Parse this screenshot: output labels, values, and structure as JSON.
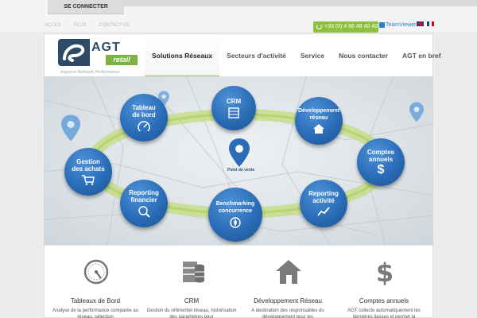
{
  "topbar": {
    "connect_label": "SE CONNECTER",
    "links": [
      "ACCES",
      "PLUS",
      "CONTACT US"
    ],
    "phone": "+33 (0) 4 66 48 40 40",
    "teamviewer": "TeamViewer"
  },
  "header": {
    "logo_agt": "AGT",
    "logo_retail": "retail",
    "tagline": "Improve Network Performance",
    "nav": [
      "Solutions Réseaux",
      "Secteurs d'activité",
      "Service",
      "Nous contacter",
      "AGT en bref"
    ]
  },
  "banner": {
    "center_label": "Point de vente",
    "bubbles": {
      "tableau": [
        "Tableau",
        "de bord"
      ],
      "crm": [
        "CRM"
      ],
      "developpement": [
        "Développement",
        "réseau"
      ],
      "comptes": [
        "Comptes",
        "annuels"
      ],
      "gestion": [
        "Gestion",
        "des achats"
      ],
      "reporting_fin": [
        "Reporting",
        "financier"
      ],
      "benchmarking": [
        "Benchmarking",
        "concurrence"
      ],
      "reporting_act": [
        "Reporting",
        "activité"
      ]
    }
  },
  "features": [
    {
      "title": "Tableaux de Bord",
      "desc": "Analyse de la performance comparée au réseau, sélection",
      "icon": "gauge-icon"
    },
    {
      "title": "CRM",
      "desc": "Gestion du référentiel réseau, historisation des paramètres pour",
      "icon": "database-icon"
    },
    {
      "title": "Développement Réseau",
      "desc": "A destination des responsables du développement pour les",
      "icon": "house-icon"
    },
    {
      "title": "Comptes annuels",
      "desc": "AGT collecte automatiquement les dernières liasses et permet la",
      "icon": "dollar-icon"
    }
  ],
  "colors": {
    "accent_green": "#8fc344",
    "bubble_blue": "#2a6cb8",
    "logo_navy": "#2d4a66"
  }
}
